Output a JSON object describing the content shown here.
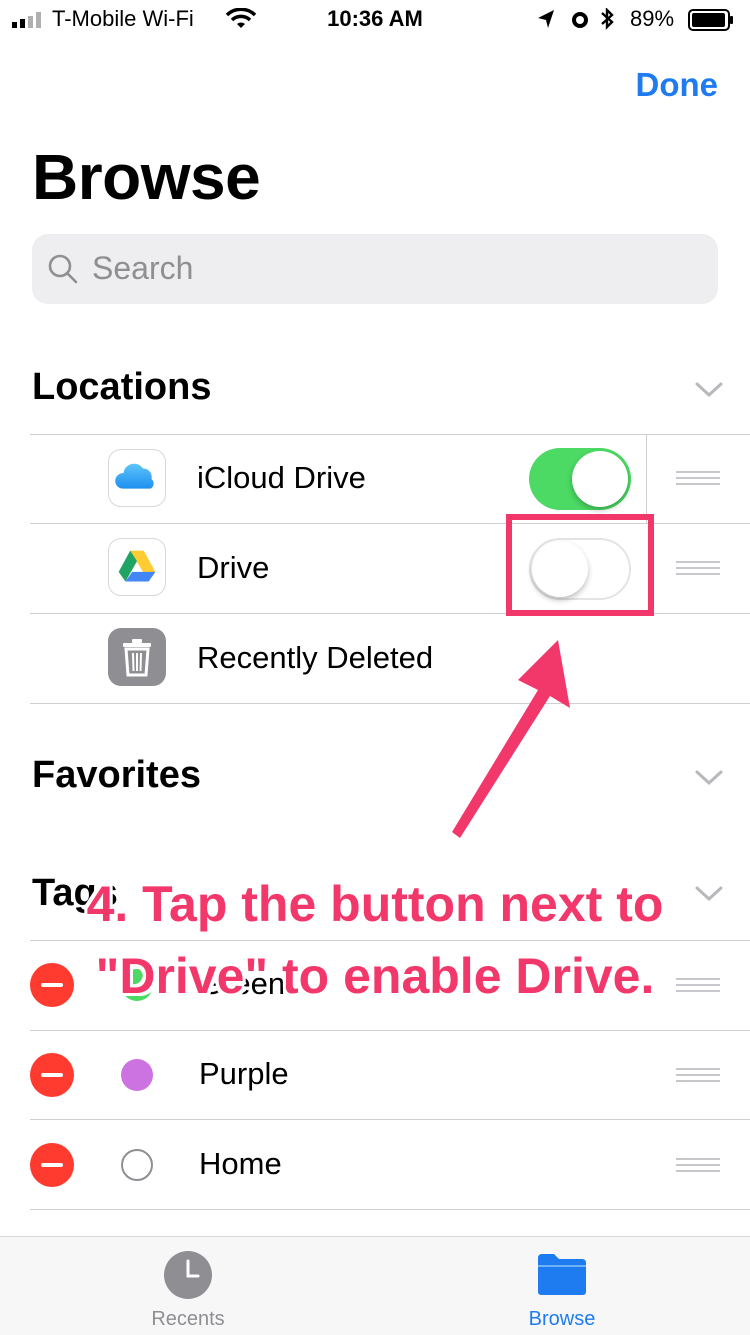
{
  "status_bar": {
    "carrier": "T-Mobile Wi-Fi",
    "time": "10:36 AM",
    "battery": "89%"
  },
  "nav": {
    "done_label": "Done"
  },
  "page_title": "Browse",
  "search": {
    "placeholder": "Search"
  },
  "sections": {
    "locations": "Locations",
    "favorites": "Favorites",
    "tags": "Tags"
  },
  "locations": [
    {
      "label": "iCloud Drive",
      "enabled": true
    },
    {
      "label": "Drive",
      "enabled": false
    },
    {
      "label": "Recently Deleted"
    }
  ],
  "tags": [
    {
      "label": "Green",
      "color": "#4cd964"
    },
    {
      "label": "Purple",
      "color": "#cc73e1"
    },
    {
      "label": "Home",
      "color": "#ffffff"
    }
  ],
  "tabbar": {
    "recents": "Recents",
    "browse": "Browse"
  },
  "annotation": {
    "line1": "4. Tap the button next to",
    "line2": "\"Drive\" to enable Drive."
  },
  "colors": {
    "accent": "#1f7cf0",
    "switch_on": "#4cd964",
    "delete": "#ff3b30",
    "annotation": "#f2386a"
  }
}
